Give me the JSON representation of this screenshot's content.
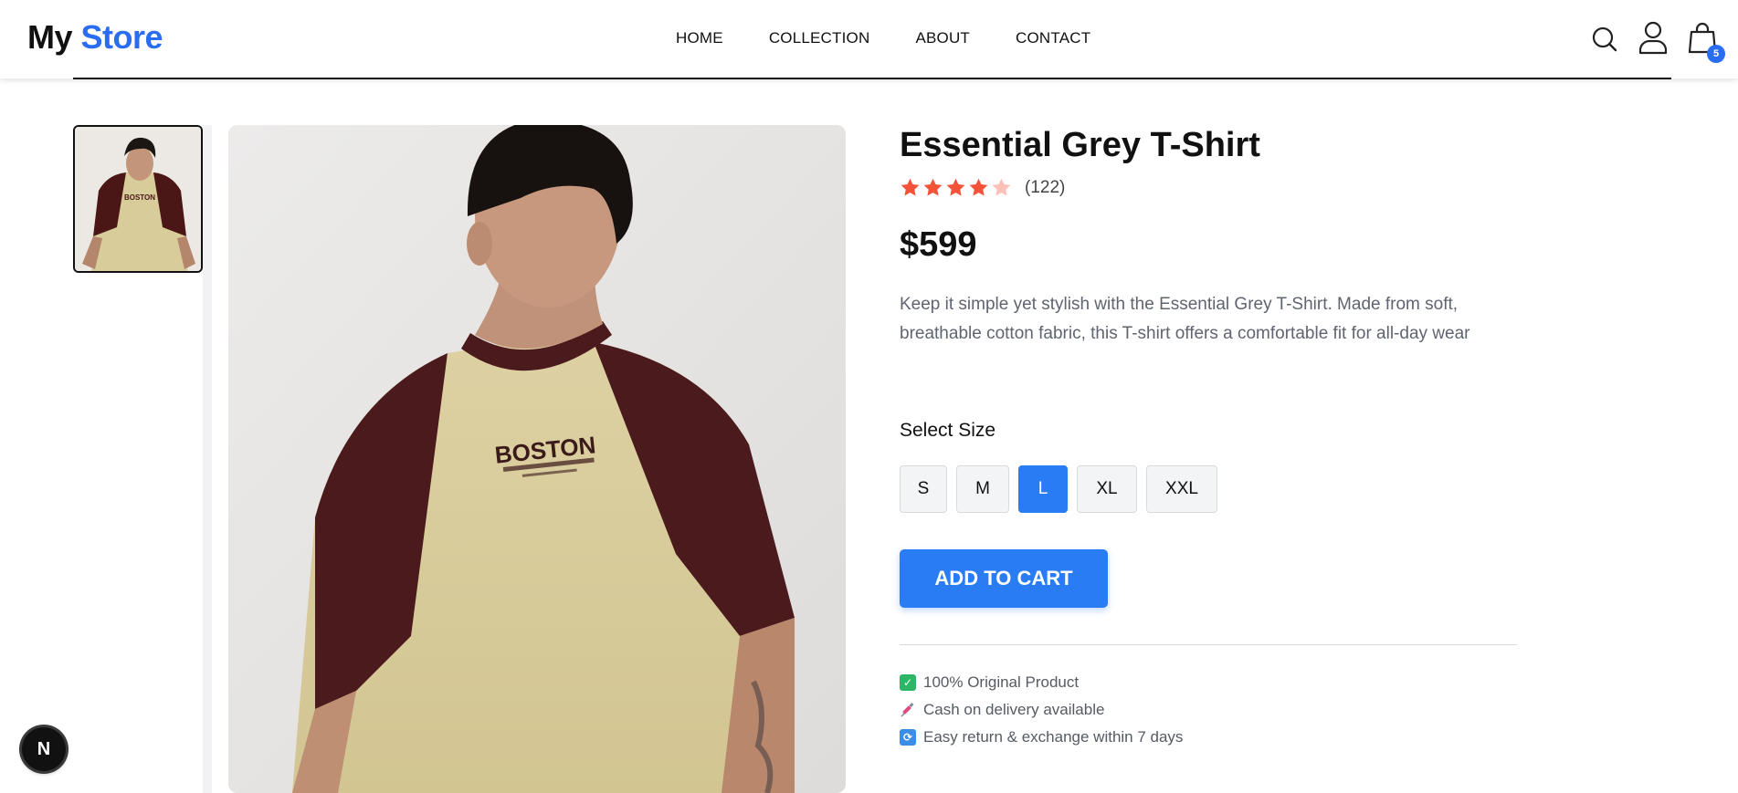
{
  "header": {
    "logo_prefix": "My",
    "logo_accent": "Store",
    "nav": [
      "HOME",
      "COLLECTION",
      "ABOUT",
      "CONTACT"
    ],
    "icons": [
      "search-icon",
      "user-icon",
      "shopping-bag-icon"
    ],
    "cart_count": "5"
  },
  "gallery": {
    "thumbnail_alt": "product-thumbnail",
    "shirt_print": "BOSTON"
  },
  "product": {
    "title": "Essential Grey T-Shirt",
    "rating": 4,
    "rating_max": 5,
    "review_count": "(122)",
    "price": "$599",
    "description": "Keep it simple yet stylish with the Essential Grey T-Shirt. Made from soft, breathable cotton fabric, this T-shirt offers a comfortable fit for all-day wear",
    "size_label": "Select Size",
    "sizes": [
      "S",
      "M",
      "L",
      "XL",
      "XXL"
    ],
    "selected_size": "L",
    "add_to_cart": "ADD TO CART",
    "features": [
      {
        "icon": "check-icon",
        "text": "100% Original Product"
      },
      {
        "icon": "syringe-icon",
        "text": "Cash on delivery available"
      },
      {
        "icon": "exchange-icon",
        "text": "Easy return & exchange within 7 days"
      }
    ]
  },
  "dev": {
    "badge_letter": "N"
  },
  "colors": {
    "accent": "#2a6df2",
    "button": "#2a7cf5",
    "star_filled": "#f4533a",
    "star_empty": "#fbc1b8"
  }
}
